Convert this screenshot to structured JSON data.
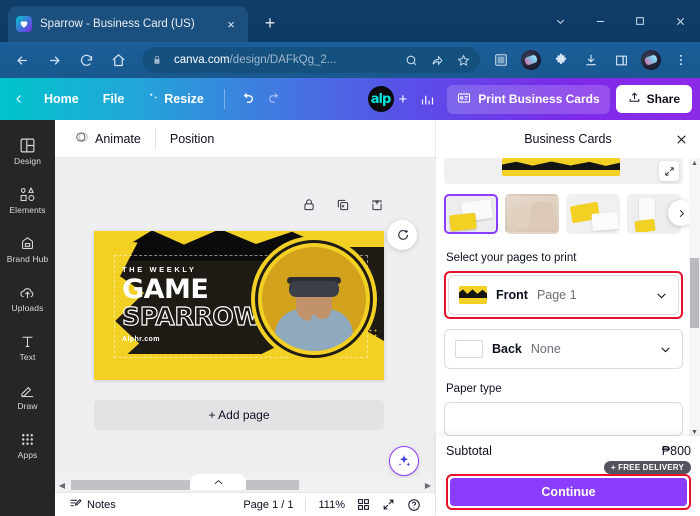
{
  "browser": {
    "tab": {
      "title": "Sparrow - Business Card (US)",
      "favicon": "canva-heart-icon",
      "close": "×"
    },
    "new_tab_label": "+",
    "window_controls": [
      "chevron-down",
      "minimize",
      "maximize",
      "close"
    ],
    "url_host": "canva.com",
    "url_path": "/design/DAFkQg_2...",
    "toolbar_icons": [
      "back",
      "forward",
      "reload",
      "home",
      "lock",
      "zoom",
      "share",
      "bookmark",
      "reading-list",
      "profile-pic",
      "extensions",
      "downloads",
      "sidepanel",
      "account-avatar",
      "menu"
    ]
  },
  "canva_toolbar": {
    "home": "Home",
    "file": "File",
    "resize": "Resize",
    "undo": "undo-icon",
    "redo": "redo-icon",
    "brand_logo": "alp",
    "add_label": "+",
    "insights": "insights-icon",
    "print_label": "Print Business Cards",
    "share_label": "Share"
  },
  "sub_toolbar": {
    "animate": "Animate",
    "position": "Position"
  },
  "sidebar": {
    "items": [
      {
        "label": "Design",
        "icon": "design-icon"
      },
      {
        "label": "Elements",
        "icon": "elements-icon"
      },
      {
        "label": "Brand Hub",
        "icon": "brand-hub-icon"
      },
      {
        "label": "Uploads",
        "icon": "uploads-icon"
      },
      {
        "label": "Text",
        "icon": "text-icon"
      },
      {
        "label": "Draw",
        "icon": "draw-icon"
      },
      {
        "label": "Apps",
        "icon": "apps-icon"
      }
    ]
  },
  "canvas": {
    "float_tools": [
      "lock-icon",
      "duplicate-icon",
      "add-icon"
    ],
    "comment_button": "comment-icon",
    "magic_button": "magic-studio-icon",
    "add_page_label": "+ Add page",
    "design": {
      "eyebrow": "THE WEEKLY",
      "title_line1": "GAME",
      "title_line2": "SPARROW",
      "website": "Alphr.com"
    }
  },
  "statusbar": {
    "notes": "Notes",
    "page_indicator": "Page 1 / 1",
    "zoom": "111%",
    "grid_view": "grid-view-icon",
    "fullscreen": "fullscreen-icon",
    "help": "help-icon"
  },
  "right_panel": {
    "title": "Business Cards",
    "close": "×",
    "expand_preview": "expand-icon",
    "thumbnails": [
      {
        "name": "mockup-cards-on-white",
        "selected": true
      },
      {
        "name": "mockup-hands-desk",
        "selected": false
      },
      {
        "name": "mockup-card-stack",
        "selected": false
      },
      {
        "name": "mockup-desk-scene",
        "selected": false
      }
    ],
    "next_thumb": "chevron-right-icon",
    "select_pages_label": "Select your pages to print",
    "pages": [
      {
        "side": "Front",
        "value": "Page 1",
        "has_thumb": true,
        "highlighted": true
      },
      {
        "side": "Back",
        "value": "None",
        "has_thumb": false,
        "highlighted": false
      }
    ],
    "paper_type_label": "Paper type",
    "subtotal_label": "Subtotal",
    "subtotal_value": "₱800",
    "free_delivery_badge": "+ FREE DELIVERY",
    "continue_label": "Continue"
  },
  "colors": {
    "accent_purple": "#8b3dff",
    "highlight_red": "#e8112d",
    "canva_teal": "#00c4cc",
    "browser_blue": "#1a5c96",
    "design_yellow": "#f2d024"
  }
}
